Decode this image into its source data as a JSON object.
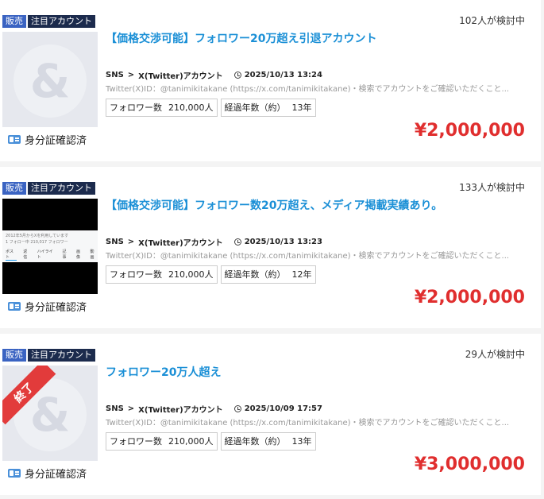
{
  "listings": [
    {
      "tags": [
        "販売",
        "注目アカウント"
      ],
      "watchers": "102人が検討中",
      "title": "【価格交渉可能】フォロワー20万超え引退アカウント",
      "category": "SNS",
      "category_arrow": ">",
      "subcategory": "X(Twitter)アカウント",
      "date": "2025/10/13 13:24",
      "description": "Twitter(X)ID：@tanimikitakane (https://x.com/tanimikitakane)・検索でアカウントをご確認いただくこと...",
      "followers_label": "フォロワー数",
      "followers_value": "210,000人",
      "years_label": "経過年数（約）",
      "years_value": "13年",
      "verified": "身分証確認済",
      "price": "¥2,000,000",
      "thumb_type": "placeholder",
      "status_ended": false
    },
    {
      "tags": [
        "販売",
        "注目アカウント"
      ],
      "watchers": "133人が検討中",
      "title": "【価格交渉可能】フォロワー数20万超え、メディア掲載実績あり。",
      "category": "SNS",
      "category_arrow": ">",
      "subcategory": "X(Twitter)アカウント",
      "date": "2025/10/13 13:23",
      "description": "Twitter(X)ID：@tanimikitakane (https://x.com/tanimikitakane)・検索でアカウントをご確認いただくこと...",
      "followers_label": "フォロワー数",
      "followers_value": "210,000人",
      "years_label": "経過年数（約）",
      "years_value": "12年",
      "verified": "身分証確認済",
      "price": "¥2,000,000",
      "thumb_type": "screenshot",
      "thumb_lines": [
        "2012年5月からXを利用しています",
        "1 フォロー中  210,017 フォロワー"
      ],
      "thumb_tabs": [
        "ポスト",
        "返信",
        "ハイライト",
        "記事",
        "画像",
        "動画",
        "記事"
      ],
      "status_ended": false
    },
    {
      "tags": [
        "販売",
        "注目アカウント"
      ],
      "watchers": "29人が検討中",
      "title": "フォロワー20万人超え",
      "category": "SNS",
      "category_arrow": ">",
      "subcategory": "X(Twitter)アカウント",
      "date": "2025/10/09 17:57",
      "description": "Twitter(X)ID：@tanimikitakane (https://x.com/tanimikitakane)・検索でアカウントをご確認いただくこと...",
      "followers_label": "フォロワー数",
      "followers_value": "210,000人",
      "years_label": "経過年数（約）",
      "years_value": "13年",
      "verified": "身分証確認済",
      "price": "¥3,000,000",
      "thumb_type": "placeholder",
      "status_ended": true,
      "status_label": "終了"
    }
  ],
  "placeholder_glyph": "&",
  "colors": {
    "price": "#e02e2e",
    "title": "#1a8fd6",
    "tag_sale": "#3a63c2",
    "tag_featured": "#1c2b4d",
    "ended_band": "#e23b3b"
  }
}
